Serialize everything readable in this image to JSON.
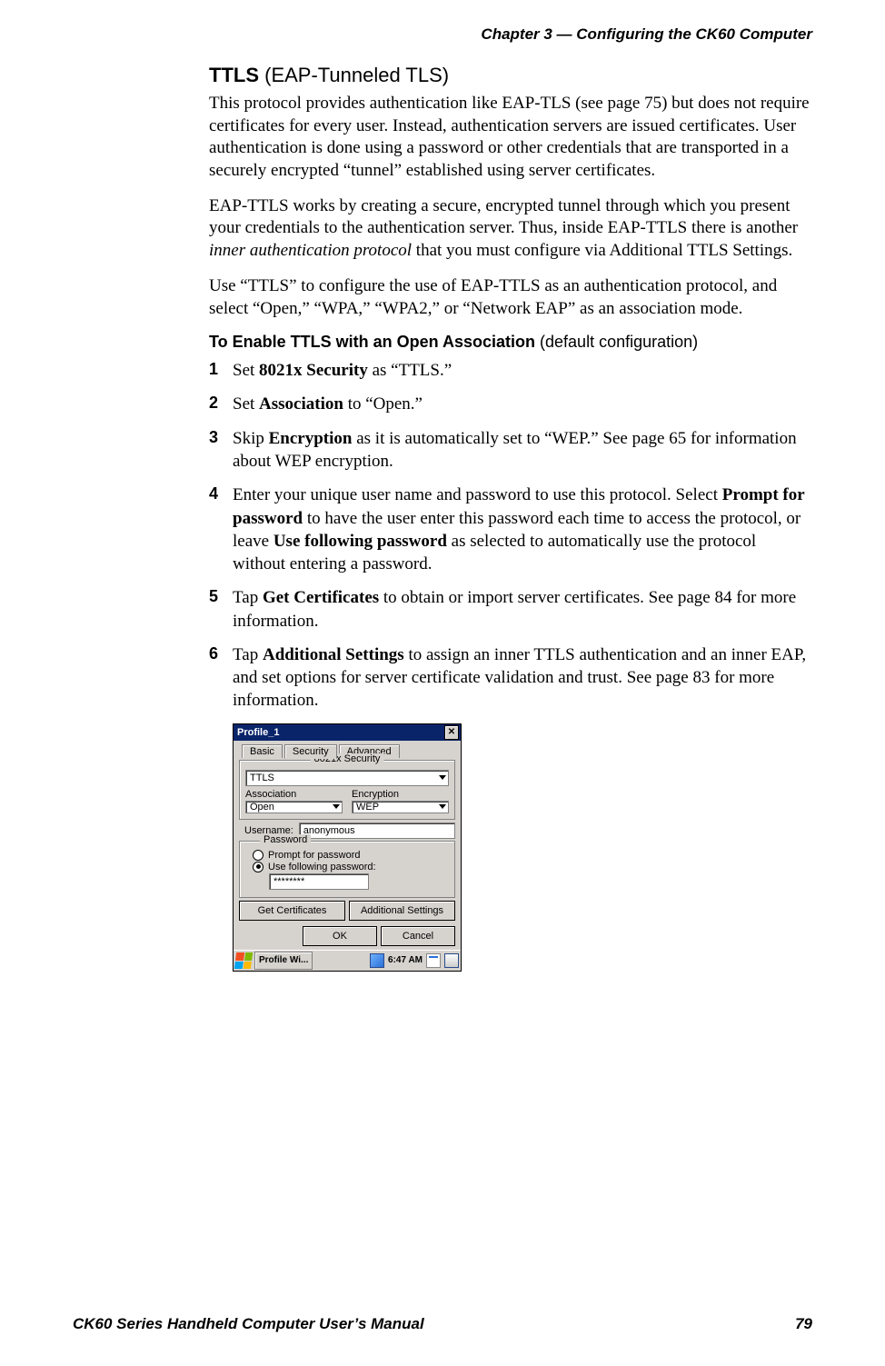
{
  "chapter_header": "Chapter 3 —  Configuring the CK60 Computer",
  "section": {
    "title_bold": "TTLS",
    "title_rest": " (EAP-Tunneled TLS)",
    "para1": "This protocol provides authentication like EAP-TLS (see page 75) but does not require certificates for every user. Instead, authentication servers are issued certificates. User authentication is done using a password or other credentials that are transported in a securely encrypted “tunnel” established using server certificates.",
    "para2_pre": "EAP-TTLS works by creating a secure, encrypted tunnel through which you present your credentials to the authentication server. Thus, inside EAP-TTLS there is another ",
    "para2_em": "inner authentication protocol",
    "para2_post": " that you must configure via Additional TTLS Settings.",
    "para3": "Use “TTLS” to configure the use of EAP-TTLS as an authentication protocol, and select “Open,” “WPA,” “WPA2,” or “Network EAP” as an association mode.",
    "subheading_bold": "To Enable TTLS with an Open Association",
    "subheading_rest": " (default configuration)"
  },
  "steps": {
    "s1_pre": "Set ",
    "s1_b": "8021x Security",
    "s1_post": " as “TTLS.”",
    "s2_pre": "Set ",
    "s2_b": "Association",
    "s2_post": " to “Open.”",
    "s3_pre": "Skip ",
    "s3_b": "Encryption",
    "s3_post": " as it is automatically set to “WEP.” See page 65 for information about WEP encryption.",
    "s4_pre": "Enter your unique user name and password to use this protocol. Select ",
    "s4_b1": "Prompt for password",
    "s4_mid": " to have the user enter this password each time to access the protocol, or leave ",
    "s4_b2": "Use following password",
    "s4_post": " as selected to automatically use the protocol without entering a password.",
    "s5_pre": "Tap ",
    "s5_b": "Get Certificates",
    "s5_post": " to obtain or import server certificates. See page 84 for more information.",
    "s6_pre": "Tap ",
    "s6_b": "Additional Settings",
    "s6_post": " to assign an inner TTLS authentication and an inner EAP, and set options for server certificate validation and trust. See page 83 for more information."
  },
  "dialog": {
    "title": "Profile_1",
    "tabs": {
      "basic": "Basic",
      "security": "Security",
      "advanced": "Advanced"
    },
    "group_security": "8021x Security",
    "security_value": "TTLS",
    "assoc_label": "Association",
    "assoc_value": "Open",
    "encr_label": "Encryption",
    "encr_value": "WEP",
    "username_label": "Username:",
    "username_value": "anonymous",
    "password_legend": "Password",
    "radio_prompt": "Prompt for password",
    "radio_use": "Use following password:",
    "password_value": "********",
    "btn_getcert": "Get Certificates",
    "btn_addl": "Additional Settings",
    "btn_ok": "OK",
    "btn_cancel": "Cancel",
    "taskbar_app": "Profile Wi...",
    "taskbar_time": "6:47 AM"
  },
  "footer": {
    "manual": "CK60 Series Handheld Computer User’s Manual",
    "page": "79"
  }
}
